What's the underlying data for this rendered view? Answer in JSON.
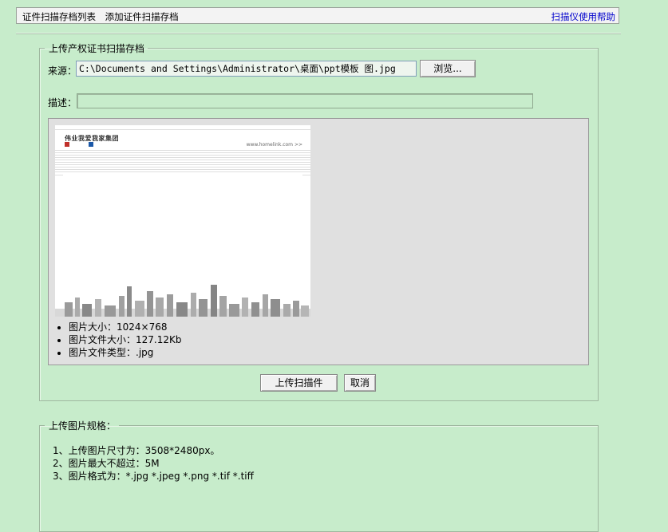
{
  "topbar": {
    "nav_items": [
      "证件扫描存档列表",
      "添加证件扫描存档"
    ],
    "help_link": "扫描仪使用帮助"
  },
  "upload_form": {
    "legend": "上传产权证书扫描存档",
    "source_label": "来源：",
    "source_value": "C:\\Documents and Settings\\Administrator\\桌面\\ppt模板 图.jpg",
    "browse_button": "浏览...",
    "description_label": "描述：",
    "description_value": "",
    "preview": {
      "logo_text": "伟业我爱我家集团",
      "url_text": "www.homelink.com  >>"
    },
    "image_info": [
      "图片大小：1024×768",
      "图片文件大小：127.12Kb",
      "图片文件类型：.jpg"
    ],
    "upload_button": "上传扫描件",
    "cancel_button": "取消"
  },
  "spec": {
    "legend": "上传图片规格：",
    "items": [
      "1、上传图片尺寸为：3508*2480px。",
      "2、图片最大不超过：5M",
      "3、图片格式为：*.jpg *.jpeg *.png *.tif *.tiff"
    ]
  }
}
